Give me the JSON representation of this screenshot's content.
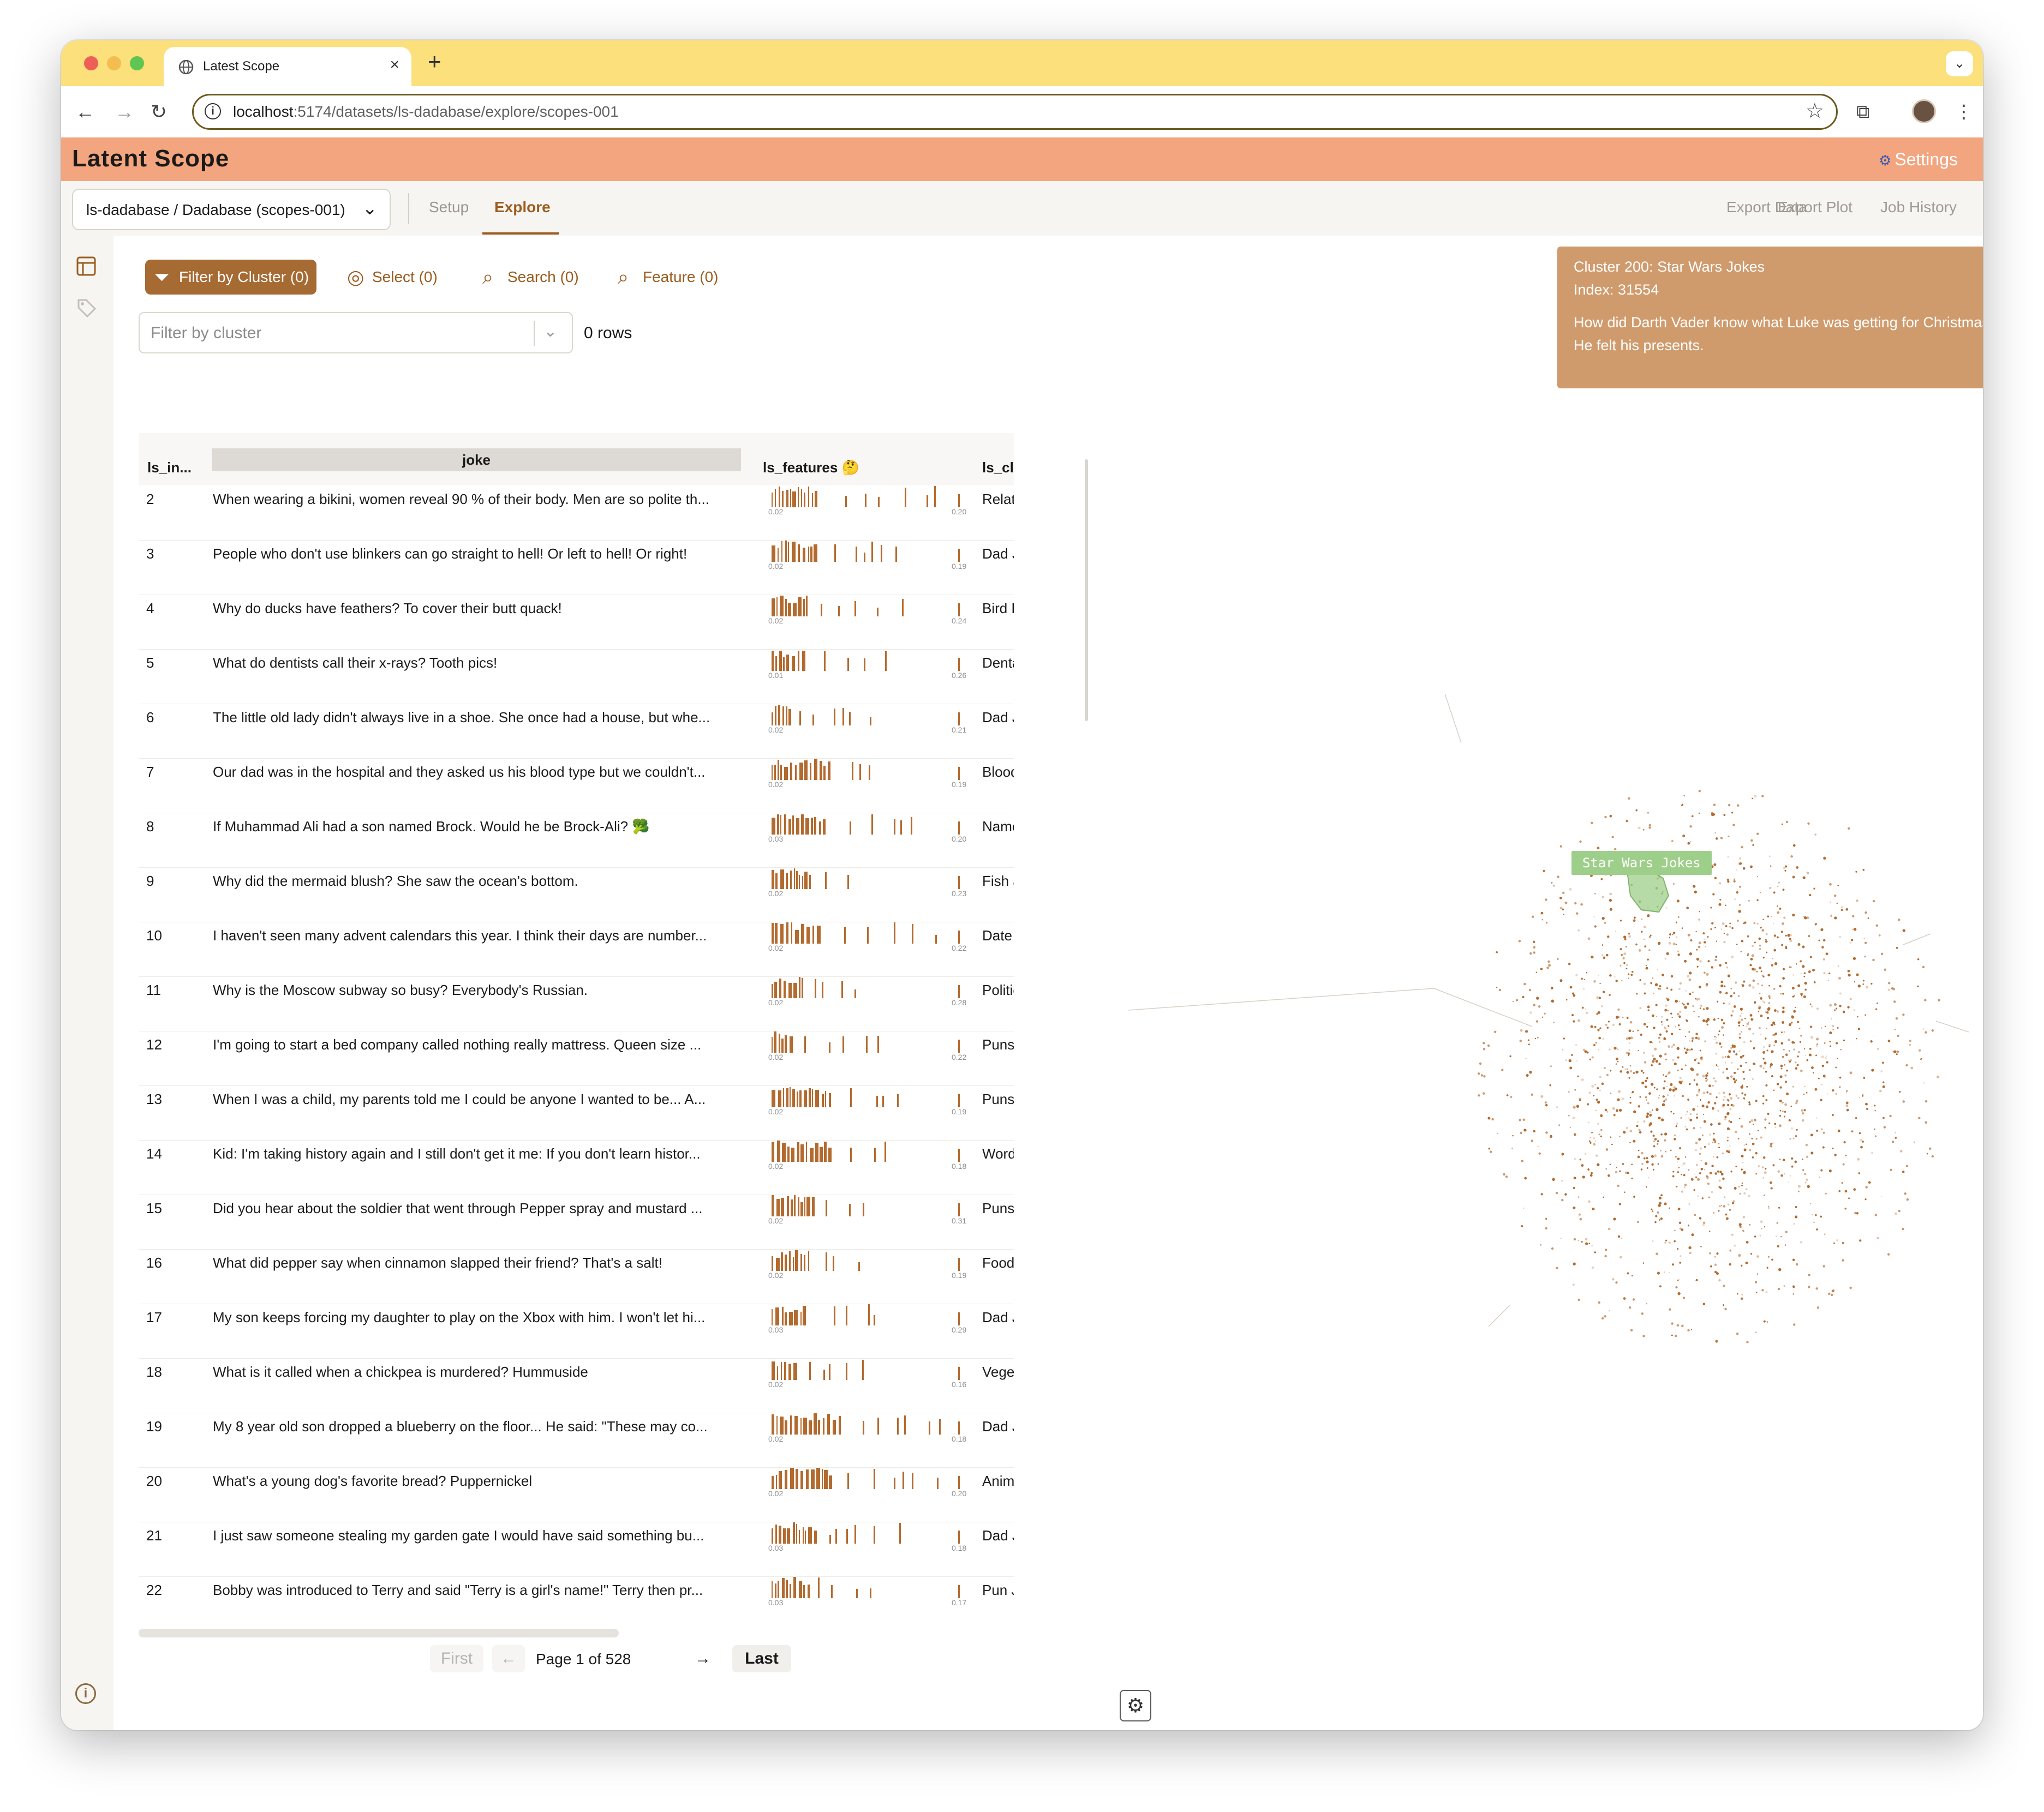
{
  "browser": {
    "tab_title": "Latest Scope",
    "url_host": "localhost",
    "url_path": ":5174/datasets/ls-dadabase/explore/scopes-001",
    "new_tab": "+",
    "close": "×"
  },
  "app": {
    "title": "Latent Scope",
    "settings": "Settings",
    "dataset_selector": "ls-dadabase / Dadabase (scopes-001)",
    "tabs": [
      "Setup",
      "Explore"
    ],
    "active_tab": "Explore",
    "actions": [
      "Export Data",
      "Export Plot",
      "Job History"
    ]
  },
  "filters": {
    "buttons": [
      {
        "label": "Filter by Cluster (0)",
        "icon": "filter-icon",
        "active": true
      },
      {
        "label": "Select (0)",
        "icon": "crosshair-icon",
        "active": false
      },
      {
        "label": "Search (0)",
        "icon": "search-icon",
        "active": false
      },
      {
        "label": "Feature (0)",
        "icon": "search-icon",
        "active": false
      }
    ],
    "cluster_placeholder": "Filter by cluster",
    "row_count": "0 rows"
  },
  "table": {
    "columns": {
      "index": "ls_in...",
      "joke": "joke",
      "features": "ls_features 🤔",
      "cluster": "ls_clu"
    },
    "rows": [
      {
        "idx": "2",
        "joke": "When wearing a bikini, women reveal 90 % of their body. Men are so polite th...",
        "min": "0.02",
        "max": "0.20",
        "cluster": "Relati"
      },
      {
        "idx": "3",
        "joke": "People who don't use blinkers can go straight to hell! Or left to hell! Or right!",
        "min": "0.02",
        "max": "0.19",
        "cluster": "Dad J"
      },
      {
        "idx": "4",
        "joke": "Why do ducks have feathers? To cover their butt quack!",
        "min": "0.02",
        "max": "0.24",
        "cluster": "Bird F"
      },
      {
        "idx": "5",
        "joke": "What do dentists call their x-rays? Tooth pics!",
        "min": "0.01",
        "max": "0.26",
        "cluster": "Denta"
      },
      {
        "idx": "6",
        "joke": "The little old lady didn't always live in a shoe. She once had a house, but whe...",
        "min": "0.02",
        "max": "0.21",
        "cluster": "Dad J"
      },
      {
        "idx": "7",
        "joke": "Our dad was in the hospital and they asked us his blood type but we couldn't...",
        "min": "0.02",
        "max": "0.19",
        "cluster": "Blood"
      },
      {
        "idx": "8",
        "joke": "If Muhammad Ali had a son named Brock. Would he be Brock-Ali? 🥦",
        "min": "0.03",
        "max": "0.20",
        "cluster": "Name"
      },
      {
        "idx": "9",
        "joke": "Why did the mermaid blush? She saw the ocean's bottom.",
        "min": "0.02",
        "max": "0.23",
        "cluster": "Fish a"
      },
      {
        "idx": "10",
        "joke": "I haven't seen many advent calendars this year. I think their days are number...",
        "min": "0.02",
        "max": "0.22",
        "cluster": "Date a"
      },
      {
        "idx": "11",
        "joke": "Why is the Moscow subway so busy? Everybody's Russian.",
        "min": "0.02",
        "max": "0.28",
        "cluster": "Politic"
      },
      {
        "idx": "12",
        "joke": "I'm going to start a bed company called nothing really mattress. Queen size ...",
        "min": "0.02",
        "max": "0.22",
        "cluster": "Puns"
      },
      {
        "idx": "13",
        "joke": "When I was a child, my parents told me I could be anyone I wanted to be... A...",
        "min": "0.02",
        "max": "0.19",
        "cluster": "Puns"
      },
      {
        "idx": "14",
        "joke": "Kid: I'm taking history again and I still don't get it me: If you don't learn histor...",
        "min": "0.02",
        "max": "0.18",
        "cluster": "Word"
      },
      {
        "idx": "15",
        "joke": "Did you hear about the soldier that went through Pepper spray and mustard ...",
        "min": "0.02",
        "max": "0.31",
        "cluster": "Puns"
      },
      {
        "idx": "16",
        "joke": "What did pepper say when cinnamon slapped their friend? That's a salt!",
        "min": "0.02",
        "max": "0.19",
        "cluster": "Food"
      },
      {
        "idx": "17",
        "joke": "My son keeps forcing my daughter to play on the Xbox with him. I won't let hi...",
        "min": "0.03",
        "max": "0.29",
        "cluster": "Dad J"
      },
      {
        "idx": "18",
        "joke": "What is it called when a chickpea is murdered? Hummuside",
        "min": "0.02",
        "max": "0.16",
        "cluster": "Veget"
      },
      {
        "idx": "19",
        "joke": "My 8 year old son dropped a blueberry on the floor... He said: \"These may co...",
        "min": "0.02",
        "max": "0.18",
        "cluster": "Dad J"
      },
      {
        "idx": "20",
        "joke": "What's a young dog's favorite bread? Puppernickel",
        "min": "0.02",
        "max": "0.20",
        "cluster": "Anima"
      },
      {
        "idx": "21",
        "joke": "I just saw someone stealing my garden gate I would have said something bu...",
        "min": "0.03",
        "max": "0.18",
        "cluster": "Dad J"
      },
      {
        "idx": "22",
        "joke": "Bobby was introduced to Terry and said \"Terry is a girl's name!\" Terry then pr...",
        "min": "0.03",
        "max": "0.17",
        "cluster": "Pun J"
      }
    ],
    "pager": {
      "first": "First",
      "prev": "←",
      "indicator": "Page 1 of 528",
      "next": "→",
      "last": "Last"
    }
  },
  "scatter": {
    "tooltip": {
      "title": "Cluster 200: Star Wars Jokes",
      "index": "Index: 31554",
      "text": "How did Darth Vader know what Luke was getting for Christmas? He felt his presents."
    },
    "cluster_label": "Star Wars Jokes",
    "point_color": "#b36a2e",
    "hull_color": "#9ecf8a"
  },
  "colors": {
    "accent": "#9c5c1f",
    "header": "#f2a57f",
    "tabstrip": "#fbe07b"
  }
}
